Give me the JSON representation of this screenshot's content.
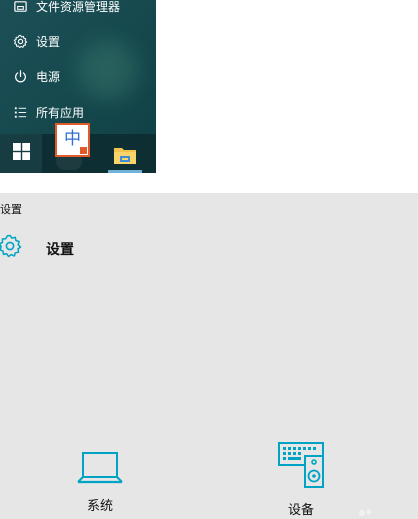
{
  "start_menu": {
    "items": [
      {
        "label": "文件资源管理器",
        "icon": "file-explorer-icon"
      },
      {
        "label": "设置",
        "icon": "gear-icon"
      },
      {
        "label": "电源",
        "icon": "power-icon"
      },
      {
        "label": "所有应用",
        "icon": "all-apps-icon"
      }
    ],
    "ime_indicator": "中"
  },
  "taskbar": {
    "start_icon": "windows-logo-icon",
    "pinned": [
      {
        "icon": "folder-icon"
      }
    ]
  },
  "settings": {
    "window_title": "设置",
    "header_title": "设置",
    "tiles": [
      {
        "label": "系统",
        "icon": "laptop-icon"
      },
      {
        "label": "设备",
        "icon": "keyboard-speaker-icon"
      }
    ]
  },
  "colors": {
    "start_bg": "#164a4f",
    "taskbar_bg": "#0d2f33",
    "accent": "#00a3c4",
    "ime_border": "#e05a2a",
    "ime_text": "#2f6fcf",
    "settings_bg": "#e6e6e6"
  }
}
